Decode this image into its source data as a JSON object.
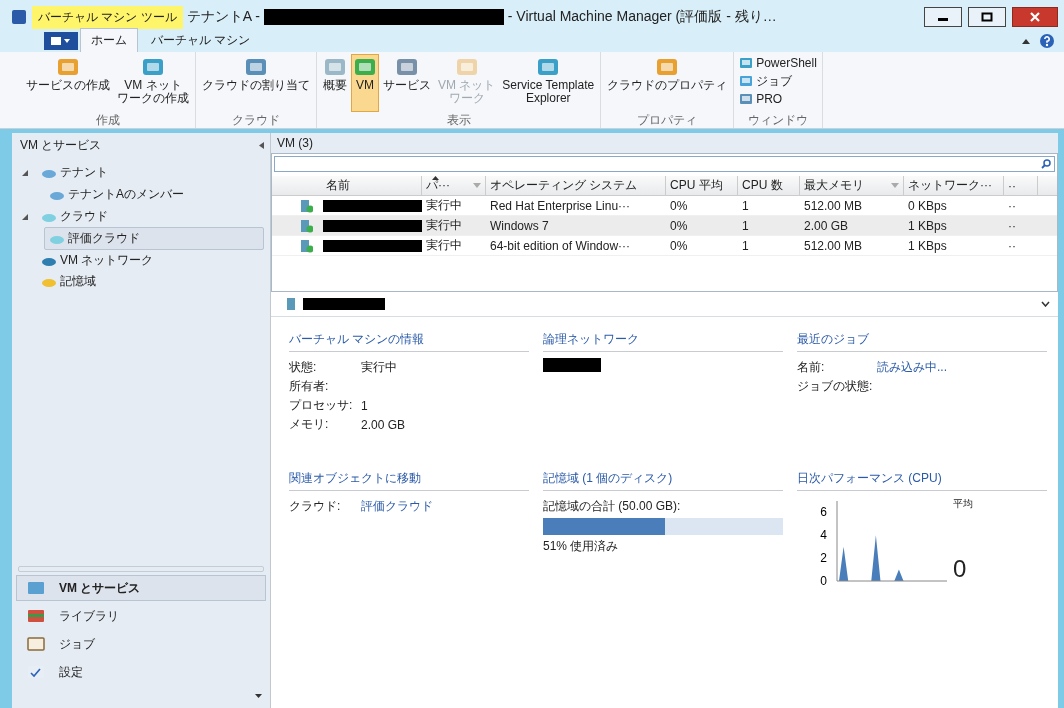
{
  "window": {
    "context_tab": "バーチャル マシン ツール",
    "title_prefix": "テナントA -",
    "title_redacted": true,
    "title_suffix": "- Virtual Machine Manager (評価版 - 残り…"
  },
  "ribbon": {
    "tabs": [
      {
        "label": "ホーム",
        "selected": true
      },
      {
        "label": "バーチャル マシン",
        "selected": false
      }
    ],
    "groups": [
      {
        "label": "作成",
        "buttons": [
          {
            "lines": [
              "サービスの作成"
            ],
            "kind": "large",
            "selected": false,
            "disabled": false
          },
          {
            "lines": [
              "VM ネット",
              "ワークの作成"
            ],
            "kind": "large",
            "selected": false,
            "disabled": false
          }
        ]
      },
      {
        "label": "クラウド",
        "buttons": [
          {
            "lines": [
              "クラウドの割り当て"
            ],
            "kind": "large",
            "selected": false,
            "disabled": false
          }
        ]
      },
      {
        "label": "表示",
        "buttons": [
          {
            "lines": [
              "概要"
            ],
            "kind": "large",
            "selected": false,
            "disabled": false
          },
          {
            "lines": [
              "VM"
            ],
            "kind": "large",
            "selected": true,
            "disabled": false
          },
          {
            "lines": [
              "サービス"
            ],
            "kind": "large",
            "selected": false,
            "disabled": false
          },
          {
            "lines": [
              "VM ネット",
              "ワーク"
            ],
            "kind": "large",
            "selected": false,
            "disabled": true
          },
          {
            "lines": [
              "Service Template",
              "Explorer"
            ],
            "kind": "large",
            "selected": false,
            "disabled": false
          }
        ]
      },
      {
        "label": "プロパティ",
        "buttons": [
          {
            "lines": [
              "クラウドのプロパティ"
            ],
            "kind": "large",
            "selected": false,
            "disabled": false
          }
        ]
      },
      {
        "label": "ウィンドウ",
        "buttons": [
          {
            "lines": [
              "PowerShell"
            ],
            "kind": "small",
            "selected": false,
            "disabled": false
          },
          {
            "lines": [
              "ジョブ"
            ],
            "kind": "small",
            "selected": false,
            "disabled": false
          },
          {
            "lines": [
              "PRO"
            ],
            "kind": "small",
            "selected": false,
            "disabled": false
          }
        ]
      }
    ]
  },
  "sidebar": {
    "title": "VM とサービス",
    "tree": [
      {
        "label": "テナント",
        "expanded": true,
        "selected": false,
        "children": [
          {
            "label": "テナントAのメンバー",
            "selected": false
          }
        ]
      },
      {
        "label": "クラウド",
        "expanded": true,
        "selected": false,
        "children": [
          {
            "label": "評価クラウド",
            "selected": true
          }
        ]
      },
      {
        "label": "VM ネットワーク",
        "selected": false
      },
      {
        "label": "記憶域",
        "selected": false
      }
    ],
    "workspaces": [
      {
        "label": "VM とサービス",
        "selected": true
      },
      {
        "label": "ライブラリ",
        "selected": false
      },
      {
        "label": "ジョブ",
        "selected": false
      },
      {
        "label": "設定",
        "selected": false
      }
    ]
  },
  "vm_list": {
    "title": "VM (3)",
    "columns": [
      {
        "label": "名前",
        "sorted": false,
        "filter": false
      },
      {
        "label": "パ···",
        "sorted": true,
        "filter": true
      },
      {
        "label": "オペレーティング システム",
        "sorted": false,
        "filter": false
      },
      {
        "label": "CPU 平均",
        "sorted": false,
        "filter": false
      },
      {
        "label": "CPU 数",
        "sorted": false,
        "filter": false
      },
      {
        "label": "最大メモリ",
        "sorted": false,
        "filter": true
      },
      {
        "label": "ネットワーク···",
        "sorted": false,
        "filter": false
      },
      {
        "label": "··",
        "sorted": false,
        "filter": false
      }
    ],
    "rows": [
      {
        "name_redacted": true,
        "selected": false,
        "cells": [
          "",
          "実行中",
          "Red Hat Enterprise Linu···",
          "0%",
          "1",
          "512.00 MB",
          "0 KBps",
          "··"
        ]
      },
      {
        "name_redacted": true,
        "selected": true,
        "cells": [
          "",
          "実行中",
          "Windows 7",
          "0%",
          "1",
          "2.00 GB",
          "1 KBps",
          "··"
        ]
      },
      {
        "name_redacted": true,
        "selected": false,
        "cells": [
          "",
          "実行中",
          "64-bit edition of Window···",
          "0%",
          "1",
          "512.00 MB",
          "1 KBps",
          "··"
        ]
      }
    ]
  },
  "details": {
    "name_redacted": true,
    "vm_info": {
      "title": "バーチャル マシンの情報",
      "fields": [
        {
          "label": "状態:",
          "value": "実行中"
        },
        {
          "label": "所有者:"
        },
        {
          "label": "プロセッサ:",
          "value": "1"
        },
        {
          "label": "メモリ:",
          "value": "2.00 GB"
        }
      ]
    },
    "logical_network": {
      "title": "論理ネットワーク",
      "redacted": true
    },
    "recent_jobs": {
      "title": "最近のジョブ",
      "fields": [
        {
          "label": "名前:",
          "link": "読み込み中..."
        },
        {
          "label": "ジョブの状態:"
        }
      ]
    },
    "related": {
      "title": "関連オブジェクトに移動",
      "fields": [
        {
          "label": "クラウド:",
          "link": "評価クラウド"
        }
      ]
    },
    "storage": {
      "title": "記憶域 (1 個のディスク)",
      "total": "記憶域の合計 (50.00 GB):",
      "level": 0.51,
      "usage": "51% 使用済み"
    },
    "performance": {
      "title": "日次パフォーマンス (CPU)",
      "average_label": "平均",
      "average_value": "0",
      "chart_data": {
        "type": "area",
        "yticks": [
          0,
          2,
          4,
          6
        ],
        "ylim": [
          0,
          7
        ],
        "series": [
          {
            "color": "#4a7ebb",
            "values": [
              0,
              3,
              0,
              0,
              0,
              0,
              0,
              0,
              4,
              0,
              0,
              0,
              0,
              1,
              0,
              0,
              0,
              0,
              0,
              0,
              0,
              0,
              0,
              0
            ]
          }
        ]
      }
    }
  }
}
